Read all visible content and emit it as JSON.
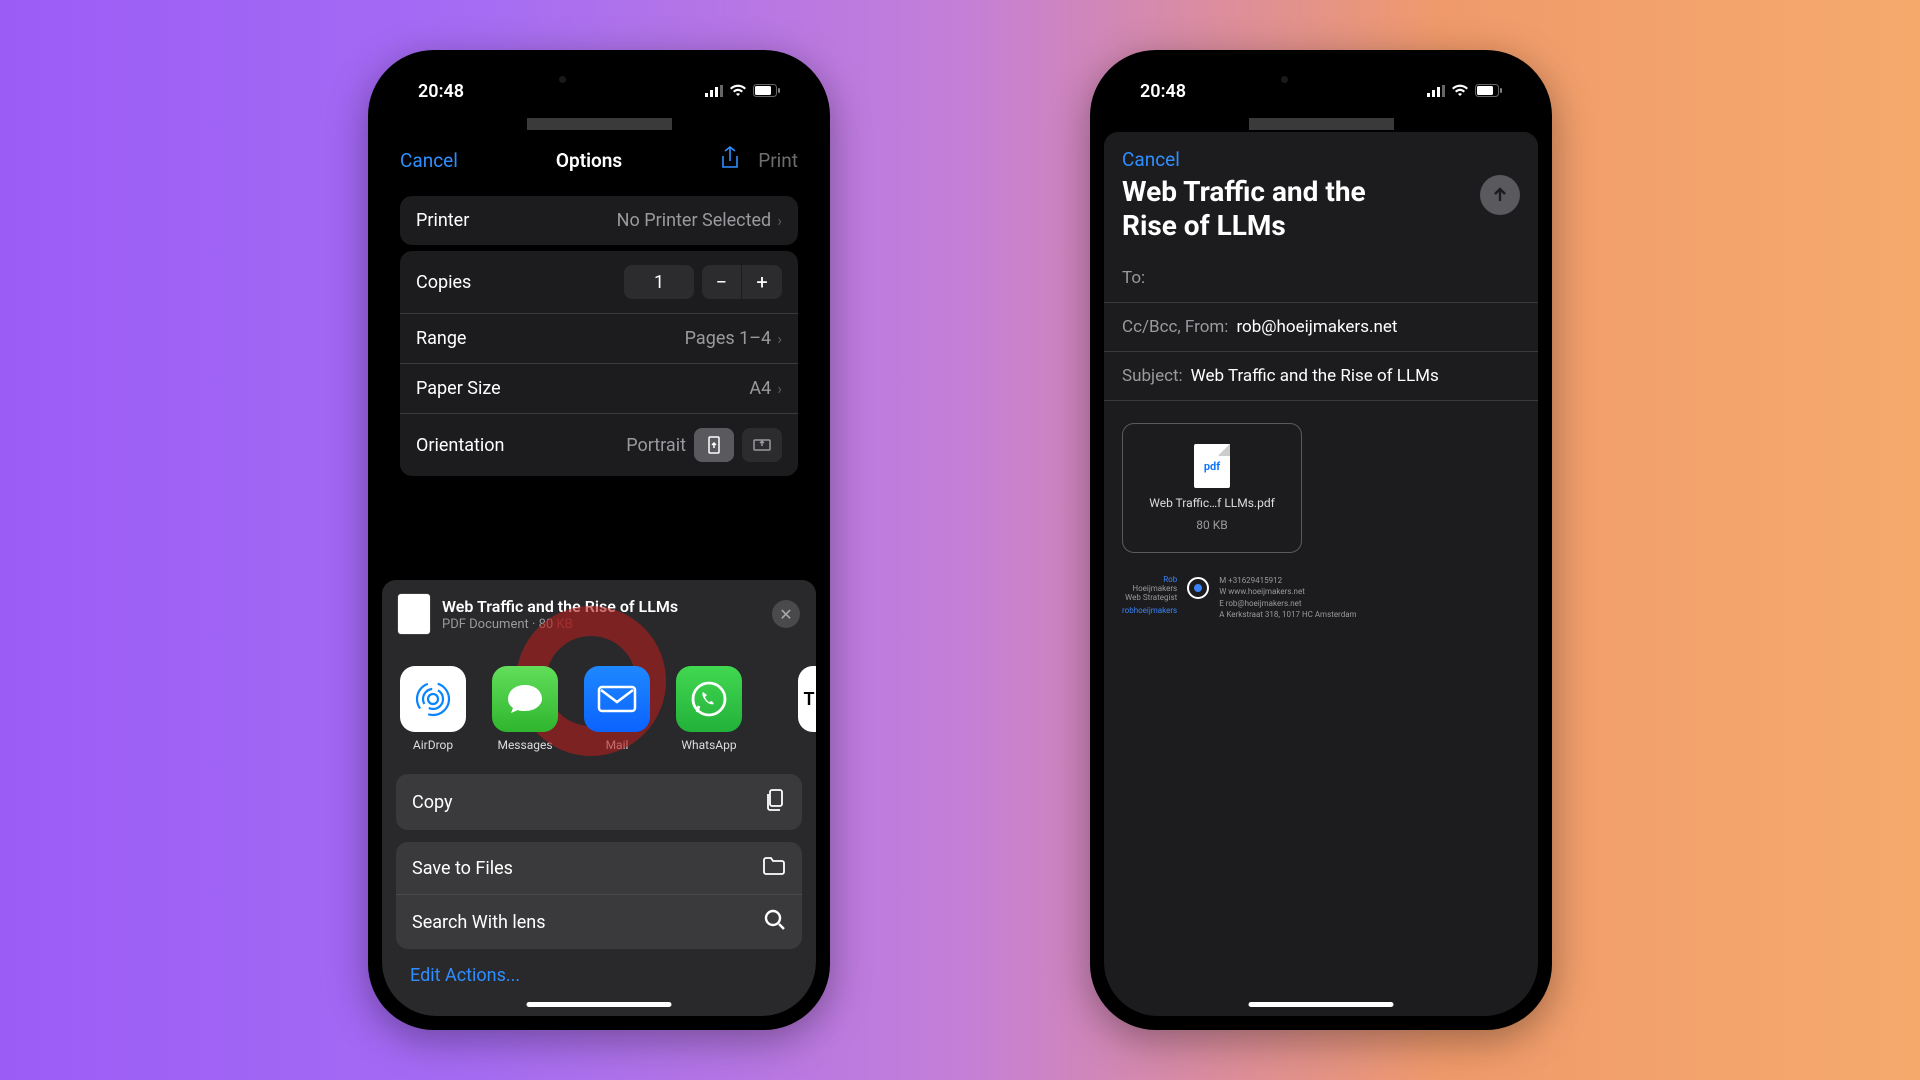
{
  "shared": {
    "time": "20:48"
  },
  "phone1": {
    "nav": {
      "cancel": "Cancel",
      "title": "Options",
      "print": "Print"
    },
    "printer": {
      "label": "Printer",
      "value": "No Printer Selected"
    },
    "copies": {
      "label": "Copies",
      "value": "1",
      "minus": "−",
      "plus": "+"
    },
    "range": {
      "label": "Range",
      "value": "Pages 1–4"
    },
    "paper": {
      "label": "Paper Size",
      "value": "A4"
    },
    "orientation": {
      "label": "Orientation",
      "value": "Portrait"
    },
    "share": {
      "title": "Web Traffic and the Rise of LLMs",
      "subtitle_a": "PDF Document · 80 ",
      "subtitle_b": "KB",
      "apps": {
        "airdrop": "AirDrop",
        "messages": "Messages",
        "mail": "Mail",
        "whatsapp": "WhatsApp",
        "peek": "T"
      },
      "actions": {
        "copy": "Copy",
        "save": "Save to Files",
        "lens": "Search With lens",
        "edit": "Edit Actions..."
      }
    }
  },
  "phone2": {
    "cancel": "Cancel",
    "title": "Web Traffic and the Rise of LLMs",
    "to_label": "To:",
    "ccbcc_label": "Cc/Bcc, From:",
    "from_value": "rob@hoeijmakers.net",
    "subject_label": "Subject:",
    "subject_value": "Web Traffic and the Rise of LLMs",
    "attachment": {
      "thumb": "pdf",
      "name": "Web Traffic…f LLMs.pdf",
      "size": "80 KB"
    },
    "signature": {
      "name": "Rob",
      "lastname": "Hoeijmakers",
      "role": "Web Strategist",
      "phone": "M +31629415912",
      "web": "W www.hoeijmakers.net",
      "email": "E rob@hoeijmakers.net",
      "addr": "A Kerkstraat 318, 1017 HC Amsterdam",
      "link": "robhoeijmakers"
    }
  }
}
